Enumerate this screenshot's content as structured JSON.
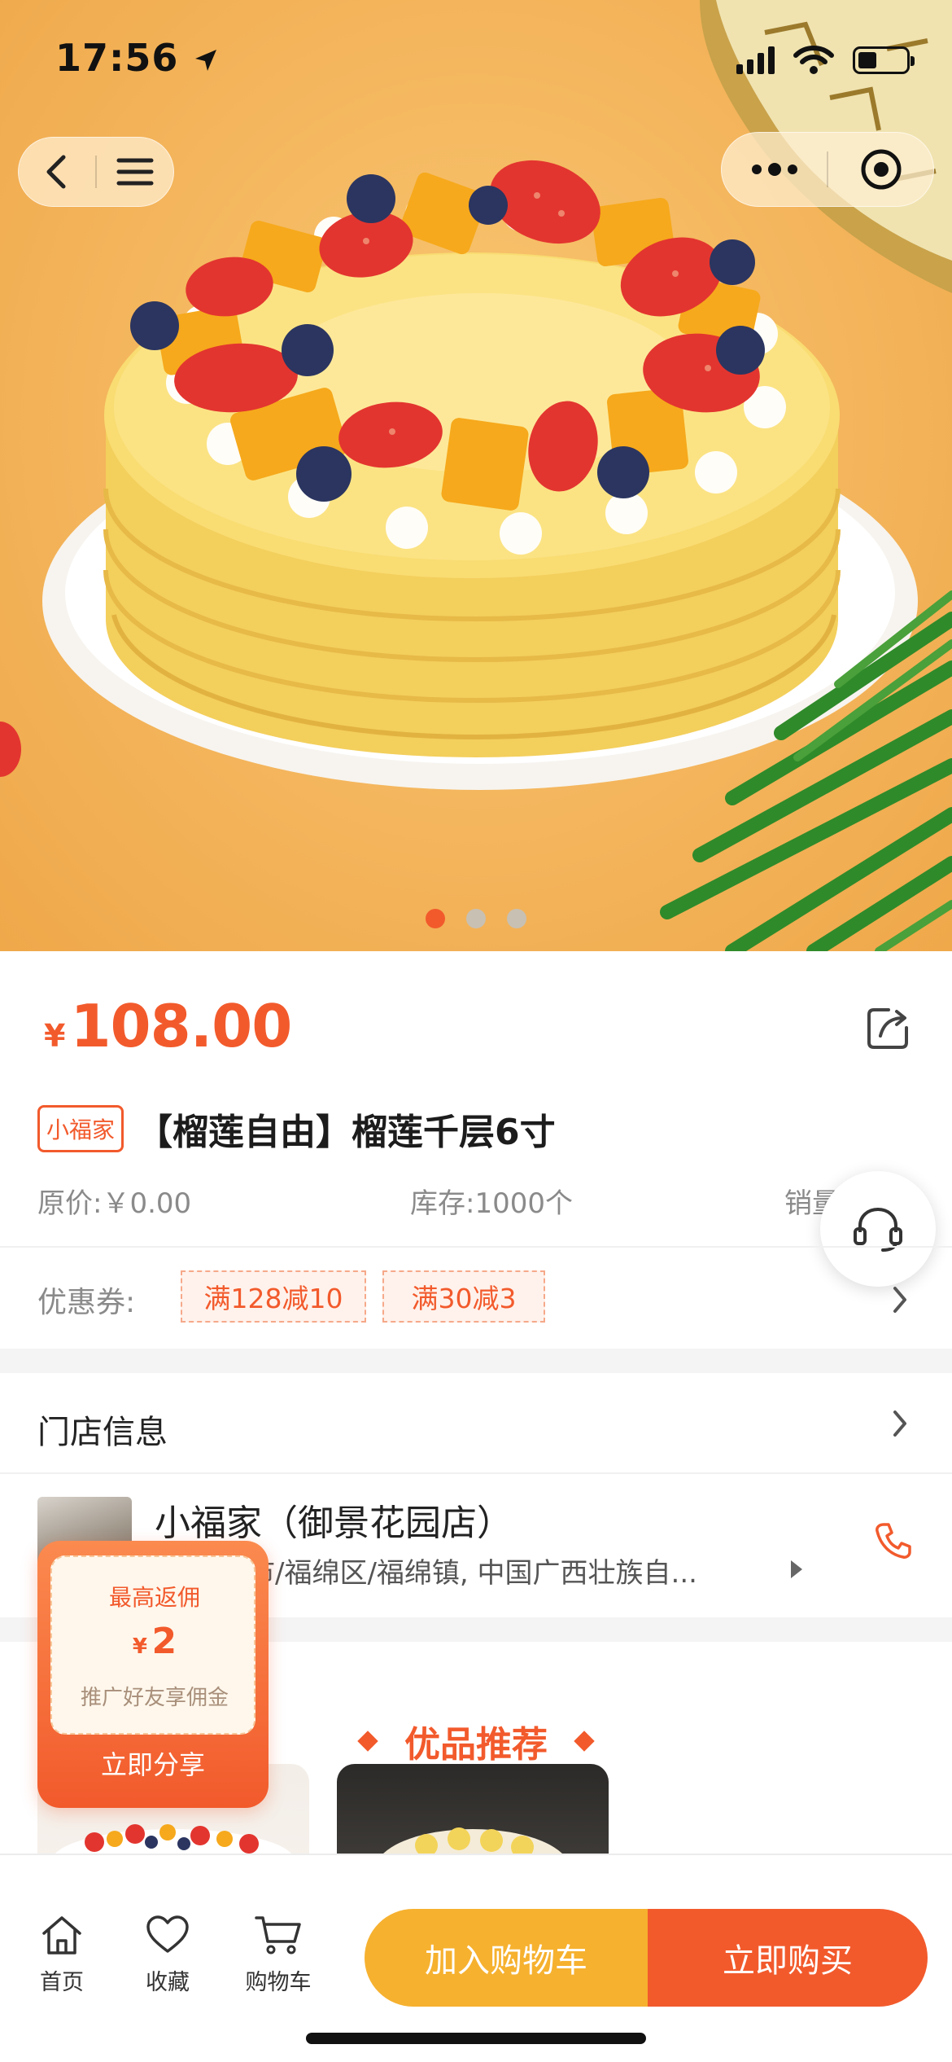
{
  "status_bar": {
    "time": "17:56"
  },
  "product": {
    "currency": "¥",
    "price": "108.00",
    "shop_tag": "小福家",
    "title": "【榴莲自由】榴莲千层6寸",
    "original_price": "原价:￥0.00",
    "stock": "库存:1000个",
    "sales": "销量",
    "coupon_label": "优惠券:",
    "coupons": [
      "满128减10",
      "满30减3"
    ],
    "carousel": {
      "count": 3,
      "active": 1
    }
  },
  "store": {
    "section_title": "门店信息",
    "name": "小福家（御景花园店）",
    "address": "林市/福绵区/福绵镇, 中国广西壮族自..."
  },
  "recommend": {
    "title": "优品推荐"
  },
  "commission_popup": {
    "title": "最高返佣",
    "currency": "¥",
    "amount": "2",
    "subtitle": "推广好友享佣金",
    "share_label": "立即分享"
  },
  "bottom_bar": {
    "tabs": [
      {
        "label": "首页",
        "icon": "home-icon"
      },
      {
        "label": "收藏",
        "icon": "heart-icon"
      },
      {
        "label": "购物车",
        "icon": "cart-icon"
      }
    ],
    "add_to_cart": "加入购物车",
    "buy_now": "立即购买"
  },
  "colors": {
    "accent": "#f25a2c",
    "cart_button": "#f6b12f",
    "hero_background": "#f4b55c"
  }
}
